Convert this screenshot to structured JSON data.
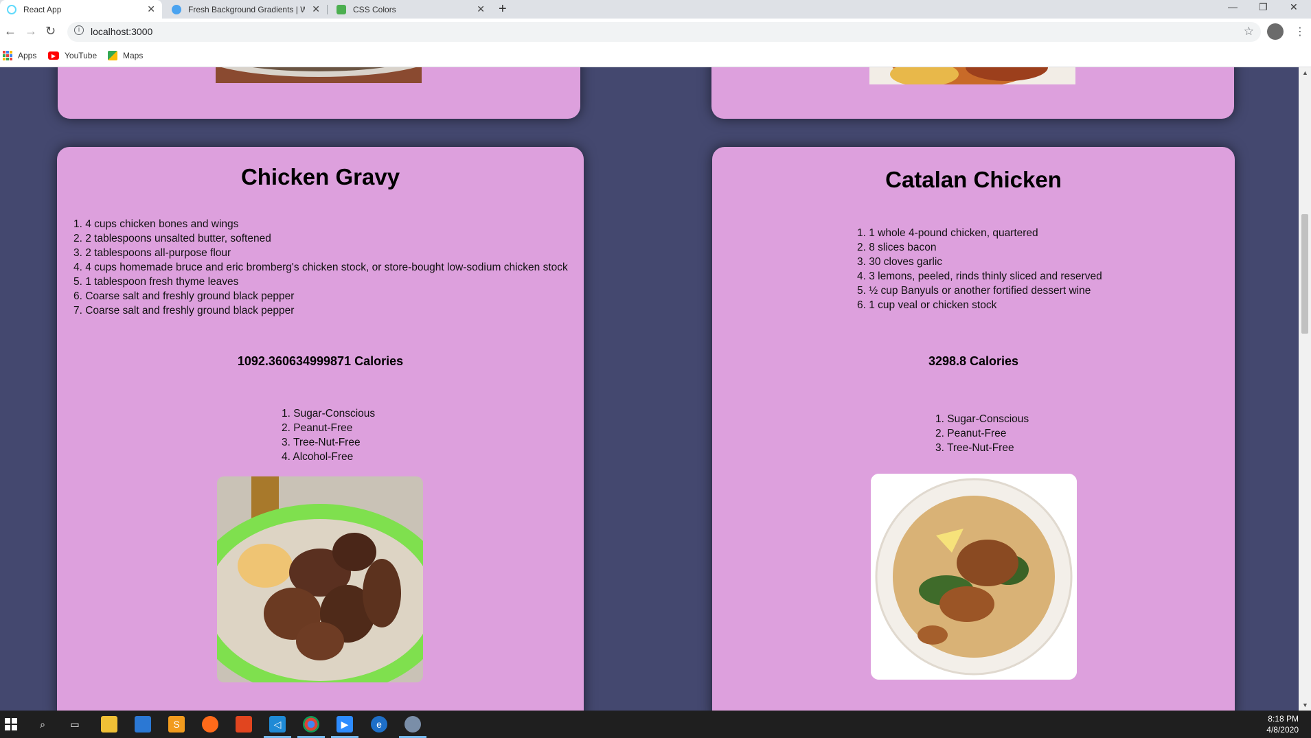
{
  "browser": {
    "tabs": [
      {
        "title": "React App",
        "active": true
      },
      {
        "title": "Fresh Background Gradients | We",
        "active": false
      },
      {
        "title": "CSS Colors",
        "active": false
      }
    ],
    "url": "localhost:3000",
    "bookmarks": [
      {
        "label": "Apps",
        "icon": "apps-grid-icon"
      },
      {
        "label": "YouTube",
        "icon": "youtube-icon"
      },
      {
        "label": "Maps",
        "icon": "maps-icon"
      }
    ]
  },
  "colors": {
    "page_background": "#44486f",
    "card_background": "#dda0dd"
  },
  "recipes": [
    {
      "title": "Chicken Gravy",
      "ingredients": [
        "1. 4 cups chicken bones and wings",
        "2. 2 tablespoons unsalted butter, softened",
        "3. 2 tablespoons all-purpose flour",
        "4. 4 cups homemade bruce and eric bromberg's chicken stock, or store-bought low-sodium chicken stock",
        "5. 1 tablespoon fresh thyme leaves",
        "6. Coarse salt and freshly ground black pepper",
        "7. Coarse salt and freshly ground black pepper"
      ],
      "calories": "1092.360634999871 Calories",
      "health_labels": [
        "1. Sugar-Conscious",
        "2. Peanut-Free",
        "3. Tree-Nut-Free",
        "4. Alcohol-Free"
      ]
    },
    {
      "title": "Catalan Chicken",
      "ingredients": [
        "1. 1 whole 4-pound chicken, quartered",
        "2. 8 slices bacon",
        "3. 30 cloves garlic",
        "4. 3 lemons, peeled, rinds thinly sliced and reserved",
        "5. ½ cup Banyuls or another fortified dessert wine",
        "6. 1 cup veal or chicken stock"
      ],
      "calories": "3298.8 Calories",
      "health_labels": [
        "1. Sugar-Conscious",
        "2. Peanut-Free",
        "3. Tree-Nut-Free"
      ]
    }
  ],
  "taskbar": {
    "time": "8:18 PM",
    "date": "4/8/2020"
  }
}
